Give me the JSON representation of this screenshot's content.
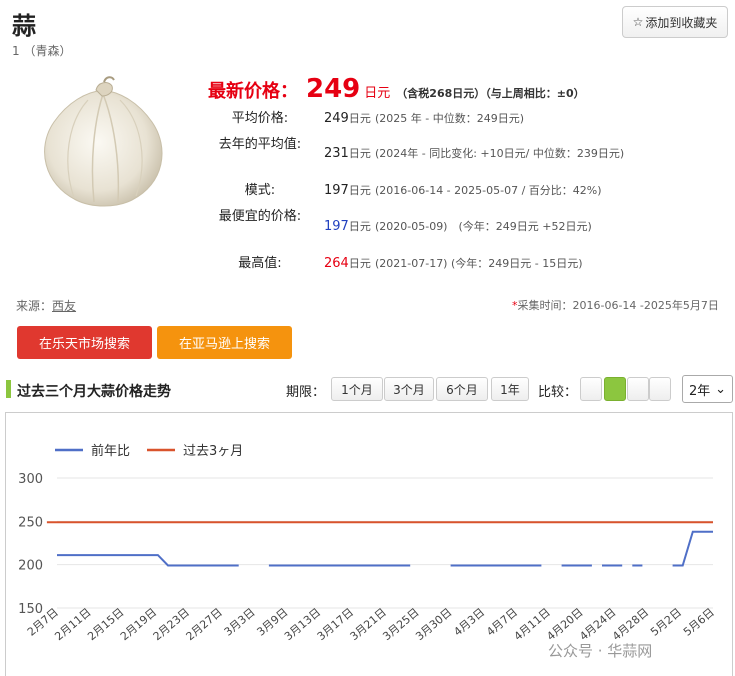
{
  "product": {
    "title": "蒜",
    "subtitle": "1 （青森）",
    "favorite_label": "添加到收藏夹"
  },
  "latest": {
    "label": "最新价格：",
    "value": "249",
    "unit": "日元",
    "note": "（含税268日元）（与上周相比：±0）"
  },
  "rows": [
    {
      "label": "平均价格:",
      "value": "249",
      "unit": "日元",
      "detail": "(2025 年 - 中位数：249日元)"
    },
    {
      "label": "去年的平均值:",
      "value": "231",
      "unit": "日元",
      "detail_a": "(2024年 - 同比变化: ",
      "detail_red": "+10日元",
      "detail_b": "/ 中位数：239日元)"
    },
    {
      "label": "模式:",
      "value": "197",
      "unit": "日元",
      "detail": "(2016-06-14 - 2025-05-07 / 百分比：42%)"
    },
    {
      "label": "最便宜的价格:",
      "value": "197",
      "unit": "日元",
      "detail_a": "(2020-05-09)　(今年：249日元 ",
      "detail_red": "+52日元",
      "detail_b": ")"
    },
    {
      "label": "最高值:",
      "value": "264",
      "unit": "日元",
      "detail_a": "(2021-07-17) (今年：249日元 - ",
      "detail_blue": "15日元",
      "detail_b": ")"
    }
  ],
  "source": {
    "label": "来源：",
    "link": "西友"
  },
  "collect": {
    "star": "*",
    "text": "采集时间：2016-06-14 -2025年5月7日"
  },
  "buttons": {
    "rakuten": "在乐天市场搜索",
    "amazon": "在亚马逊上搜索"
  },
  "section": {
    "title": "过去三个月大蒜价格走势",
    "period_label": "期限：",
    "periods": [
      "1个月",
      "3个月",
      "6个月",
      "1年"
    ],
    "compare_label": "比较：",
    "range_value": "2年"
  },
  "colors": {
    "accent_red": "#e60012",
    "accent_green": "#8cc63f",
    "series_prev": "#4f6fc7",
    "series_cur": "#d9532c"
  },
  "watermark": "公众号 · 华蒜网",
  "chart_data": {
    "type": "line",
    "title": "",
    "xlabel": "",
    "ylabel": "",
    "ylim": [
      150,
      300
    ],
    "yticks": [
      150,
      200,
      250,
      300
    ],
    "grid": true,
    "legend_position": "top-left",
    "categories": [
      "2月7日",
      "2月11日",
      "2月15日",
      "2月19日",
      "2月23日",
      "2月27日",
      "3月3日",
      "3月9日",
      "3月13日",
      "3月17日",
      "3月21日",
      "3月25日",
      "3月30日",
      "4月3日",
      "4月7日",
      "4月11日",
      "4月20日",
      "4月24日",
      "4月28日",
      "5月2日",
      "5月6日"
    ],
    "series": [
      {
        "name": "前年比",
        "color": "#4f6fc7",
        "segments": [
          [
            [
              0,
              211
            ],
            [
              10,
              211
            ],
            [
              11,
              199
            ],
            [
              18,
              199
            ]
          ],
          [
            [
              21,
              199
            ],
            [
              35,
              199
            ]
          ],
          [
            [
              39,
              199
            ],
            [
              48,
              199
            ]
          ],
          [
            [
              50,
              199
            ],
            [
              53,
              199
            ]
          ],
          [
            [
              54,
              199
            ],
            [
              56,
              199
            ]
          ],
          [
            [
              57,
              199
            ],
            [
              58,
              199
            ]
          ],
          [
            [
              61,
              199
            ],
            [
              62,
              199
            ],
            [
              63,
              238
            ],
            [
              65,
              238
            ]
          ]
        ]
      },
      {
        "name": "过去3ヶ月",
        "color": "#d9532c",
        "segments": [
          [
            [
              -1,
              249
            ],
            [
              65,
              249
            ]
          ]
        ]
      }
    ]
  }
}
